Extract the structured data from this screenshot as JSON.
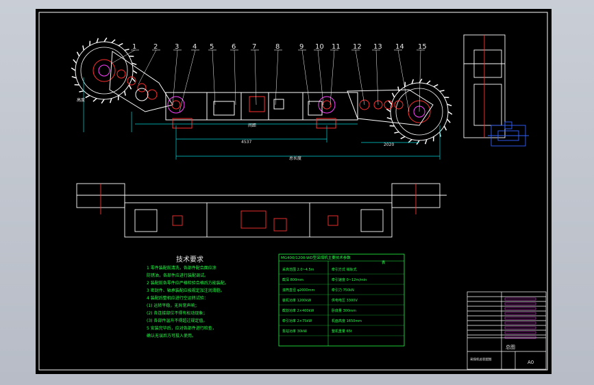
{
  "drawing": {
    "part_numbers": [
      "1",
      "2",
      "3",
      "4",
      "5",
      "6",
      "7",
      "8",
      "9",
      "10",
      "11",
      "12",
      "13",
      "14",
      "15"
    ],
    "dimension_labels": {
      "left_height": "高度",
      "mid_dim": "间距",
      "lower_dim": "4537",
      "overall": "总长度",
      "right_dim": "2020"
    }
  },
  "tech_requirements": {
    "title": "技术要求",
    "lines": [
      "1  零件装配前清洗，各部件配合面应涂",
      "   防锈油，各部件应进行装配调试。",
      "2  装配前各零件应严格检验合格后方能装配。",
      "3  密封件、轴承装配应按规定加注润滑脂。",
      "4  装配后整机应进行空运转试验：",
      "   (1) 运转平稳，无异常声响；",
      "   (2) 各连接部位不得有松动现象；",
      "   (3) 各部件温升不得超过规定值。",
      "5  安装完毕后，应对各部件进行检查，",
      "   确认无误后方可投入使用。"
    ]
  },
  "spec_table": {
    "title": "MG400/1200-WD型采煤机主要技术参数",
    "col_header": "表",
    "rows": [
      [
        "采高范围",
        "2.0~4.5m",
        "牵引方式",
        "销轨式"
      ],
      [
        "截深",
        "800mm",
        "牵引速度",
        "0~12m/min"
      ],
      [
        "滚筒直径",
        "φ2000mm",
        "牵引力",
        "750kN"
      ],
      [
        "装机功率",
        "1200kW",
        "供电电压",
        "3300V"
      ],
      [
        "截割功率",
        "2×400kW",
        "卧底量",
        "300mm"
      ],
      [
        "牵引功率",
        "2×75kW",
        "机面高度",
        "1650mm"
      ],
      [
        "泵站功率",
        "30kW",
        "整机重量",
        "65t"
      ]
    ]
  },
  "title_block": {
    "drawing_name": "总图",
    "subtitle": "采煤机总装配图",
    "sheet_no": "A0"
  }
}
